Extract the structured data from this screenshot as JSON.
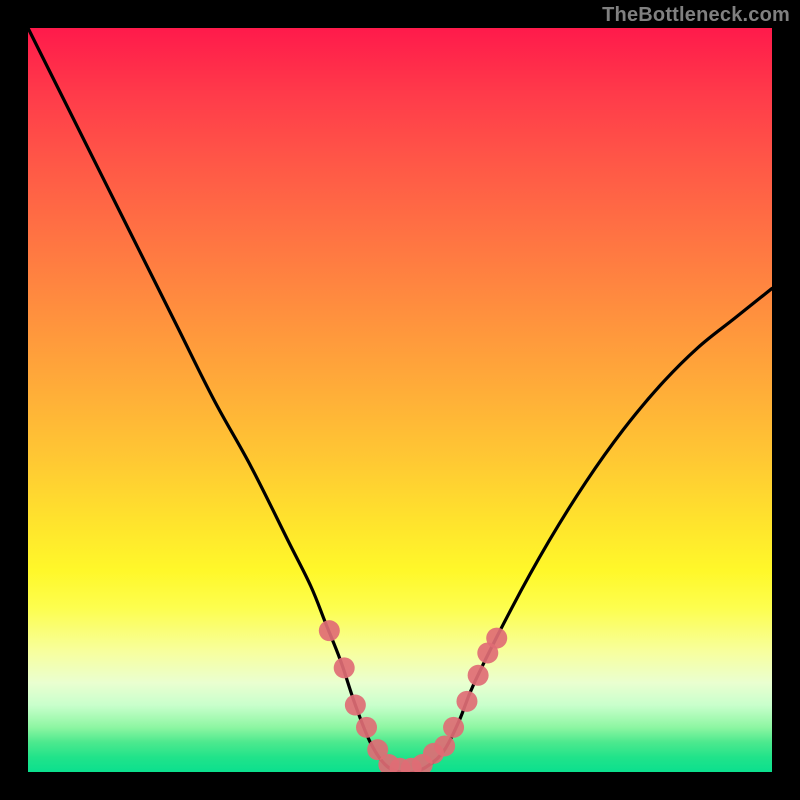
{
  "watermark": "TheBottleneck.com",
  "colors": {
    "frame": "#000000",
    "curve_stroke": "#000000",
    "marker_fill": "#e06c75",
    "gradient_stops": [
      "#ff1a4b",
      "#ff3b4a",
      "#ff5747",
      "#ff7343",
      "#ff8f3e",
      "#ffab39",
      "#ffc833",
      "#ffe22d",
      "#fff82a",
      "#fdfe4f",
      "#f7ffa0",
      "#eaffd0",
      "#c9ffcc",
      "#8df6a2",
      "#4de98e",
      "#21e38a",
      "#0be08e"
    ]
  },
  "chart_data": {
    "type": "line",
    "title": "",
    "xlabel": "",
    "ylabel": "",
    "xlim": [
      0,
      100
    ],
    "ylim": [
      0,
      100
    ],
    "series": [
      {
        "name": "bottleneck-curve",
        "x": [
          0,
          5,
          10,
          15,
          20,
          25,
          30,
          35,
          38,
          40,
          42,
          44,
          46,
          48,
          50,
          52,
          54,
          56,
          58,
          60,
          65,
          70,
          75,
          80,
          85,
          90,
          95,
          100
        ],
        "y": [
          100,
          90,
          80,
          70,
          60,
          50,
          41,
          31,
          25,
          20,
          15,
          9,
          4,
          1,
          0,
          0,
          1,
          3,
          7,
          12,
          22,
          31,
          39,
          46,
          52,
          57,
          61,
          65
        ]
      }
    ],
    "markers": {
      "name": "highlighted-points",
      "x": [
        40.5,
        42.5,
        44.0,
        45.5,
        47.0,
        48.5,
        50.0,
        51.5,
        53.0,
        54.5,
        56.0,
        57.2,
        59.0,
        60.5,
        61.8,
        63.0
      ],
      "y": [
        19.0,
        14.0,
        9.0,
        6.0,
        3.0,
        1.0,
        0.5,
        0.5,
        1.0,
        2.5,
        3.5,
        6.0,
        9.5,
        13.0,
        16.0,
        18.0
      ]
    }
  }
}
